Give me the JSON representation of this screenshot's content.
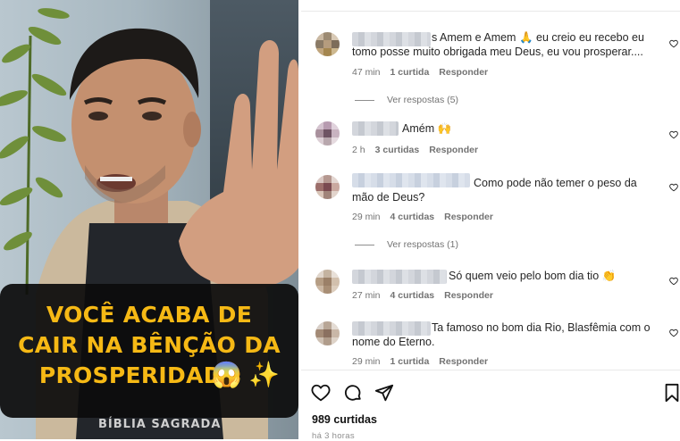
{
  "video": {
    "caption_lines": [
      "VOCÊ ACABA DE",
      "CAIR NA BÊNÇÃO DA",
      "PROSPERIDADE"
    ],
    "caption_emojis": [
      "😱",
      "✨"
    ],
    "shirt_text": "BÍBLIA SAGRADA"
  },
  "comments": [
    {
      "username": "",
      "text_parts": [
        "s Amem e Amem",
        "🙏",
        " eu creio eu recebo eu",
        "tomo posse muito obrigada meu Deus, eu vou prosperar...."
      ],
      "time": "47 min",
      "likes": "1 curtida",
      "reply": "Responder",
      "view_replies": "Ver respostas (5)"
    },
    {
      "username": "",
      "text": "Amém 🙌",
      "time": "2 h",
      "likes": "3 curtidas",
      "reply": "Responder"
    },
    {
      "username": "",
      "text_line1": "Como pode não temer o peso da",
      "text_line2": "mão de Deus?",
      "time": "29 min",
      "likes": "4 curtidas",
      "reply": "Responder",
      "view_replies": "Ver respostas (1)"
    },
    {
      "username": "",
      "text": "Só quem veio pelo bom dia tio 👏",
      "time": "27 min",
      "likes": "4 curtidas",
      "reply": "Responder"
    },
    {
      "username": "",
      "text_line1": "Ta famoso no bom dia Rio, Blasfêmia com o",
      "text_line2": "nome do Eterno.",
      "time": "29 min",
      "likes": "1 curtida",
      "reply": "Responder"
    }
  ],
  "post": {
    "likes": "989 curtidas",
    "time_ago": "há 3 horas"
  },
  "icons": [
    "heart-icon",
    "comment-icon",
    "share-icon",
    "bookmark-icon"
  ],
  "colors": {
    "caption": "#f6b915",
    "caption_bg": "#0c0c0c",
    "meta": "#737373"
  }
}
